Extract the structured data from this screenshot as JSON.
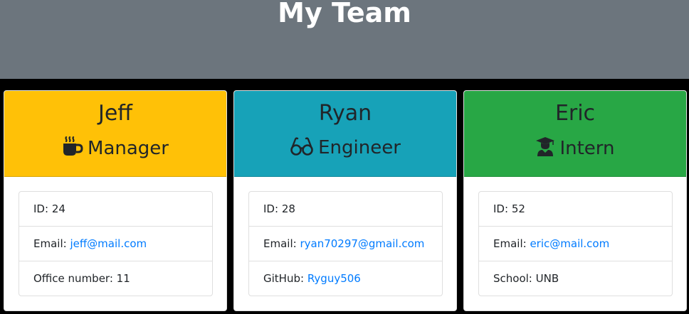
{
  "header": {
    "title": "My Team"
  },
  "colors": {
    "header_bg": "#6c757d",
    "manager": "#ffc107",
    "engineer": "#17a2b8",
    "intern": "#28a745",
    "link": "#007bff"
  },
  "cards": [
    {
      "name": "Jeff",
      "role": "Manager",
      "icon": "coffee-mug-icon",
      "id_label": "ID:",
      "id_value": "24",
      "email_label": "Email:",
      "email": "jeff@mail.com",
      "extra_label": "Office number:",
      "extra_value": "11"
    },
    {
      "name": "Ryan",
      "role": "Engineer",
      "icon": "glasses-icon",
      "id_label": "ID:",
      "id_value": "28",
      "email_label": "Email:",
      "email": "ryan70297@gmail.com",
      "extra_label": "GitHub:",
      "extra_value": "Ryguy506"
    },
    {
      "name": "Eric",
      "role": "Intern",
      "icon": "graduate-icon",
      "id_label": "ID:",
      "id_value": "52",
      "email_label": "Email:",
      "email": "eric@mail.com",
      "extra_label": "School:",
      "extra_value": "UNB"
    }
  ]
}
